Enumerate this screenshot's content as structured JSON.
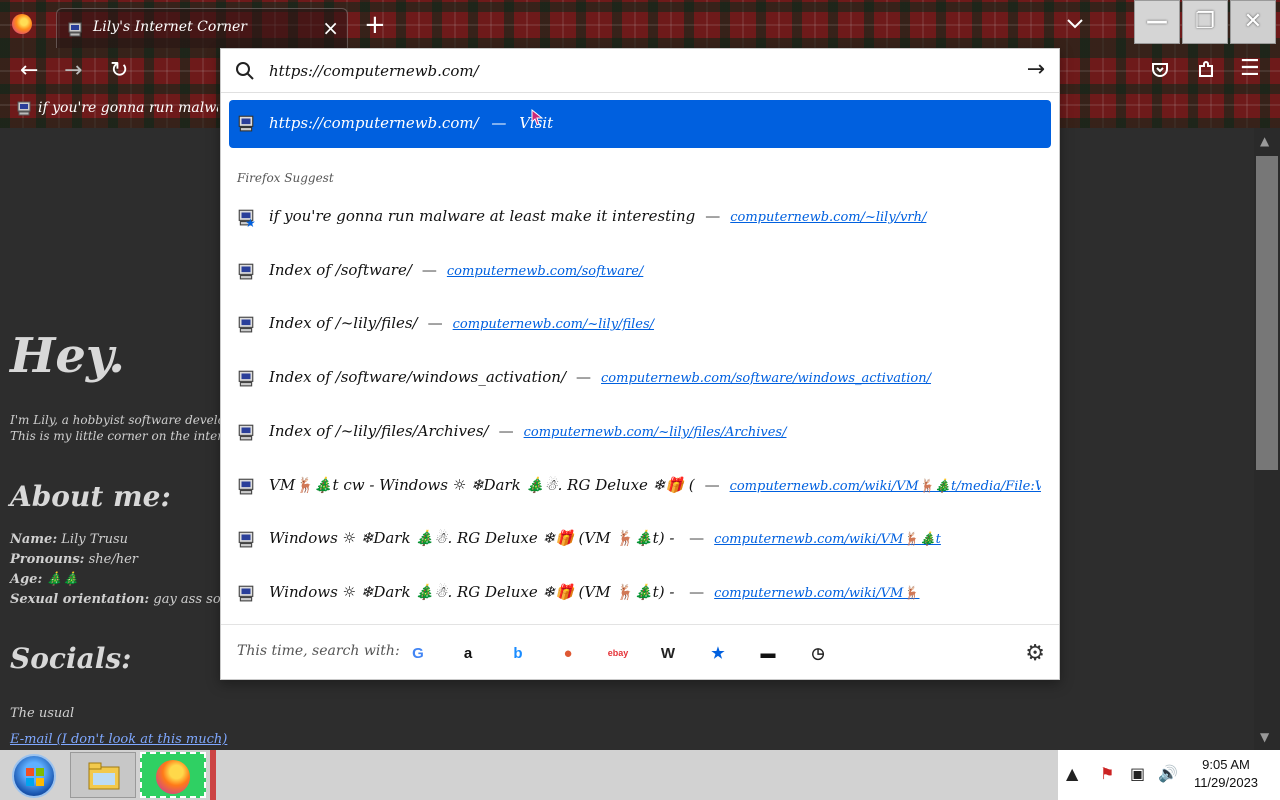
{
  "browser": {
    "tab_title": "Lily's Internet Corner",
    "new_tab_glyph": "+",
    "bookmark_text": "if you're gonna run malware at least make it interesting",
    "window_controls": {
      "minimize": "—",
      "restore": "❐",
      "close": "✕"
    }
  },
  "urlbar": {
    "value": "https://computernewb.com/",
    "go_glyph": "→"
  },
  "dropdown": {
    "selected": {
      "url": "https://computernewb.com/",
      "separator": "—",
      "action": "Visit"
    },
    "section_label": "Firefox Suggest",
    "suggestions": [
      {
        "title": "if you're gonna run malware at least make it interesting",
        "url": "computernewb.com/~lily/vrh/",
        "bookmarked": true
      },
      {
        "title": "Index of /software/",
        "url": "computernewb.com/software/",
        "bookmarked": false
      },
      {
        "title": "Index of /~lily/files/",
        "url": "computernewb.com/~lily/files/",
        "bookmarked": false
      },
      {
        "title": "Index of /software/windows_activation/",
        "url": "computernewb.com/software/windows_activation/",
        "bookmarked": false
      },
      {
        "title": "Index of /~lily/files/Archives/",
        "url": "computernewb.com/~lily/files/Archives/",
        "bookmarked": false
      },
      {
        "title": "VM🦌🎄t cw - Windows ☼ ❄Dark 🎄☃. RG Deluxe ❄🎁 (",
        "url": "computernewb.com/wiki/VM🦌🎄t/media/File:Vm🦌",
        "bookmarked": false
      },
      {
        "title": "Windows ☼ ❄Dark 🎄☃. RG Deluxe ❄🎁 (VM 🦌🎄t) - ",
        "url": "computernewb.com/wiki/VM🦌🎄t",
        "bookmarked": false
      },
      {
        "title": "Windows ☼ ❄Dark 🎄☃. RG Deluxe ❄🎁 (VM 🦌🎄t) - ",
        "url": "computernewb.com/wiki/VM🦌",
        "bookmarked": false
      }
    ],
    "footer_label": "This time, search with:",
    "engines": [
      {
        "name": "google",
        "glyph": "G",
        "color": "#4285f4"
      },
      {
        "name": "amazon",
        "glyph": "a",
        "color": "#111111"
      },
      {
        "name": "bing",
        "glyph": "b",
        "color": "#1a8cff"
      },
      {
        "name": "duckduckgo",
        "glyph": "●",
        "color": "#de5833"
      },
      {
        "name": "ebay",
        "glyph": "ebay",
        "color": "#e53238"
      },
      {
        "name": "wikipedia",
        "glyph": "W",
        "color": "#222222"
      },
      {
        "name": "bookmarks",
        "glyph": "★",
        "color": "#0060df"
      },
      {
        "name": "tabs",
        "glyph": "▬",
        "color": "#111111"
      },
      {
        "name": "history",
        "glyph": "◷",
        "color": "#222222"
      }
    ]
  },
  "page": {
    "hey": "Hey.",
    "intro_1": "I'm Lily, a hobbyist software developer and sys",
    "intro_2": "This is my little corner on the internet that I p",
    "about_heading": "About me:",
    "name_label": "Name:",
    "name_value": "Lily Trusu",
    "pronouns_label": "Pronouns:",
    "pronouns_value": "she/her",
    "age_label": "Age:",
    "age_value": "🎄🎄",
    "orientation_label": "Sexual orientation:",
    "orientation_value": "gay ass son of a bitch",
    "socials_heading": "Socials:",
    "usual": "The usual",
    "email": "E-mail (I don't look at this much)"
  },
  "taskbar": {
    "time": "9:05 AM",
    "date": "11/29/2023"
  }
}
